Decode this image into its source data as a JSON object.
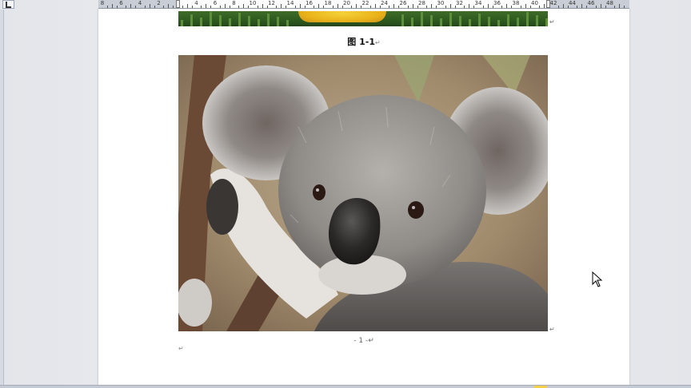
{
  "ruler": {
    "labels": [
      "8",
      "6",
      "4",
      "2",
      "2",
      "4",
      "6",
      "8",
      "10",
      "12",
      "14",
      "16",
      "18",
      "20",
      "22",
      "24",
      "26",
      "28",
      "30",
      "32",
      "34",
      "36",
      "38",
      "40",
      "42",
      "44",
      "46",
      "48"
    ]
  },
  "document": {
    "figure_caption": "图 1-1",
    "return_glyph": "↵",
    "page_number": "- 1 -"
  },
  "photo": {
    "subject": "koala"
  },
  "colors": {
    "workspace": "#e9eaee",
    "page": "#ffffff",
    "ruler_gray": "#c9cdd6",
    "zoom_indicator": "#f2d04a"
  }
}
